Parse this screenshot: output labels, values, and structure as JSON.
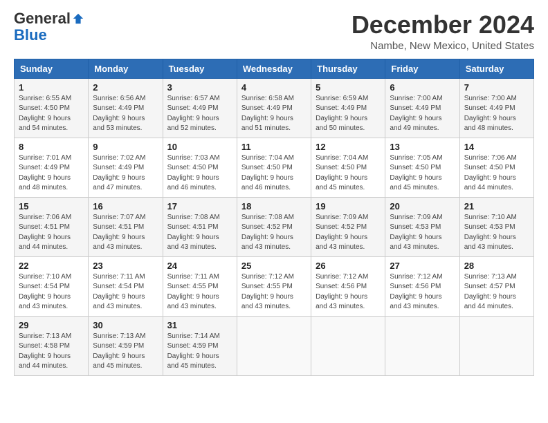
{
  "header": {
    "logo": {
      "general": "General",
      "blue": "Blue"
    },
    "title": "December 2024",
    "location": "Nambe, New Mexico, United States"
  },
  "calendar": {
    "headers": [
      "Sunday",
      "Monday",
      "Tuesday",
      "Wednesday",
      "Thursday",
      "Friday",
      "Saturday"
    ],
    "weeks": [
      [
        null,
        null,
        null,
        null,
        null,
        null,
        null
      ]
    ],
    "days": [
      {
        "date": 1,
        "dow": "Sunday",
        "sunrise": "Sunrise: 6:55 AM",
        "sunset": "Sunset: 4:50 PM",
        "daylight": "Daylight: 9 hours and 54 minutes."
      },
      {
        "date": 2,
        "dow": "Monday",
        "sunrise": "Sunrise: 6:56 AM",
        "sunset": "Sunset: 4:49 PM",
        "daylight": "Daylight: 9 hours and 53 minutes."
      },
      {
        "date": 3,
        "dow": "Tuesday",
        "sunrise": "Sunrise: 6:57 AM",
        "sunset": "Sunset: 4:49 PM",
        "daylight": "Daylight: 9 hours and 52 minutes."
      },
      {
        "date": 4,
        "dow": "Wednesday",
        "sunrise": "Sunrise: 6:58 AM",
        "sunset": "Sunset: 4:49 PM",
        "daylight": "Daylight: 9 hours and 51 minutes."
      },
      {
        "date": 5,
        "dow": "Thursday",
        "sunrise": "Sunrise: 6:59 AM",
        "sunset": "Sunset: 4:49 PM",
        "daylight": "Daylight: 9 hours and 50 minutes."
      },
      {
        "date": 6,
        "dow": "Friday",
        "sunrise": "Sunrise: 7:00 AM",
        "sunset": "Sunset: 4:49 PM",
        "daylight": "Daylight: 9 hours and 49 minutes."
      },
      {
        "date": 7,
        "dow": "Saturday",
        "sunrise": "Sunrise: 7:00 AM",
        "sunset": "Sunset: 4:49 PM",
        "daylight": "Daylight: 9 hours and 48 minutes."
      },
      {
        "date": 8,
        "dow": "Sunday",
        "sunrise": "Sunrise: 7:01 AM",
        "sunset": "Sunset: 4:49 PM",
        "daylight": "Daylight: 9 hours and 48 minutes."
      },
      {
        "date": 9,
        "dow": "Monday",
        "sunrise": "Sunrise: 7:02 AM",
        "sunset": "Sunset: 4:49 PM",
        "daylight": "Daylight: 9 hours and 47 minutes."
      },
      {
        "date": 10,
        "dow": "Tuesday",
        "sunrise": "Sunrise: 7:03 AM",
        "sunset": "Sunset: 4:50 PM",
        "daylight": "Daylight: 9 hours and 46 minutes."
      },
      {
        "date": 11,
        "dow": "Wednesday",
        "sunrise": "Sunrise: 7:04 AM",
        "sunset": "Sunset: 4:50 PM",
        "daylight": "Daylight: 9 hours and 46 minutes."
      },
      {
        "date": 12,
        "dow": "Thursday",
        "sunrise": "Sunrise: 7:04 AM",
        "sunset": "Sunset: 4:50 PM",
        "daylight": "Daylight: 9 hours and 45 minutes."
      },
      {
        "date": 13,
        "dow": "Friday",
        "sunrise": "Sunrise: 7:05 AM",
        "sunset": "Sunset: 4:50 PM",
        "daylight": "Daylight: 9 hours and 45 minutes."
      },
      {
        "date": 14,
        "dow": "Saturday",
        "sunrise": "Sunrise: 7:06 AM",
        "sunset": "Sunset: 4:50 PM",
        "daylight": "Daylight: 9 hours and 44 minutes."
      },
      {
        "date": 15,
        "dow": "Sunday",
        "sunrise": "Sunrise: 7:06 AM",
        "sunset": "Sunset: 4:51 PM",
        "daylight": "Daylight: 9 hours and 44 minutes."
      },
      {
        "date": 16,
        "dow": "Monday",
        "sunrise": "Sunrise: 7:07 AM",
        "sunset": "Sunset: 4:51 PM",
        "daylight": "Daylight: 9 hours and 43 minutes."
      },
      {
        "date": 17,
        "dow": "Tuesday",
        "sunrise": "Sunrise: 7:08 AM",
        "sunset": "Sunset: 4:51 PM",
        "daylight": "Daylight: 9 hours and 43 minutes."
      },
      {
        "date": 18,
        "dow": "Wednesday",
        "sunrise": "Sunrise: 7:08 AM",
        "sunset": "Sunset: 4:52 PM",
        "daylight": "Daylight: 9 hours and 43 minutes."
      },
      {
        "date": 19,
        "dow": "Thursday",
        "sunrise": "Sunrise: 7:09 AM",
        "sunset": "Sunset: 4:52 PM",
        "daylight": "Daylight: 9 hours and 43 minutes."
      },
      {
        "date": 20,
        "dow": "Friday",
        "sunrise": "Sunrise: 7:09 AM",
        "sunset": "Sunset: 4:53 PM",
        "daylight": "Daylight: 9 hours and 43 minutes."
      },
      {
        "date": 21,
        "dow": "Saturday",
        "sunrise": "Sunrise: 7:10 AM",
        "sunset": "Sunset: 4:53 PM",
        "daylight": "Daylight: 9 hours and 43 minutes."
      },
      {
        "date": 22,
        "dow": "Sunday",
        "sunrise": "Sunrise: 7:10 AM",
        "sunset": "Sunset: 4:54 PM",
        "daylight": "Daylight: 9 hours and 43 minutes."
      },
      {
        "date": 23,
        "dow": "Monday",
        "sunrise": "Sunrise: 7:11 AM",
        "sunset": "Sunset: 4:54 PM",
        "daylight": "Daylight: 9 hours and 43 minutes."
      },
      {
        "date": 24,
        "dow": "Tuesday",
        "sunrise": "Sunrise: 7:11 AM",
        "sunset": "Sunset: 4:55 PM",
        "daylight": "Daylight: 9 hours and 43 minutes."
      },
      {
        "date": 25,
        "dow": "Wednesday",
        "sunrise": "Sunrise: 7:12 AM",
        "sunset": "Sunset: 4:55 PM",
        "daylight": "Daylight: 9 hours and 43 minutes."
      },
      {
        "date": 26,
        "dow": "Thursday",
        "sunrise": "Sunrise: 7:12 AM",
        "sunset": "Sunset: 4:56 PM",
        "daylight": "Daylight: 9 hours and 43 minutes."
      },
      {
        "date": 27,
        "dow": "Friday",
        "sunrise": "Sunrise: 7:12 AM",
        "sunset": "Sunset: 4:56 PM",
        "daylight": "Daylight: 9 hours and 43 minutes."
      },
      {
        "date": 28,
        "dow": "Saturday",
        "sunrise": "Sunrise: 7:13 AM",
        "sunset": "Sunset: 4:57 PM",
        "daylight": "Daylight: 9 hours and 44 minutes."
      },
      {
        "date": 29,
        "dow": "Sunday",
        "sunrise": "Sunrise: 7:13 AM",
        "sunset": "Sunset: 4:58 PM",
        "daylight": "Daylight: 9 hours and 44 minutes."
      },
      {
        "date": 30,
        "dow": "Monday",
        "sunrise": "Sunrise: 7:13 AM",
        "sunset": "Sunset: 4:59 PM",
        "daylight": "Daylight: 9 hours and 45 minutes."
      },
      {
        "date": 31,
        "dow": "Tuesday",
        "sunrise": "Sunrise: 7:14 AM",
        "sunset": "Sunset: 4:59 PM",
        "daylight": "Daylight: 9 hours and 45 minutes."
      }
    ]
  }
}
